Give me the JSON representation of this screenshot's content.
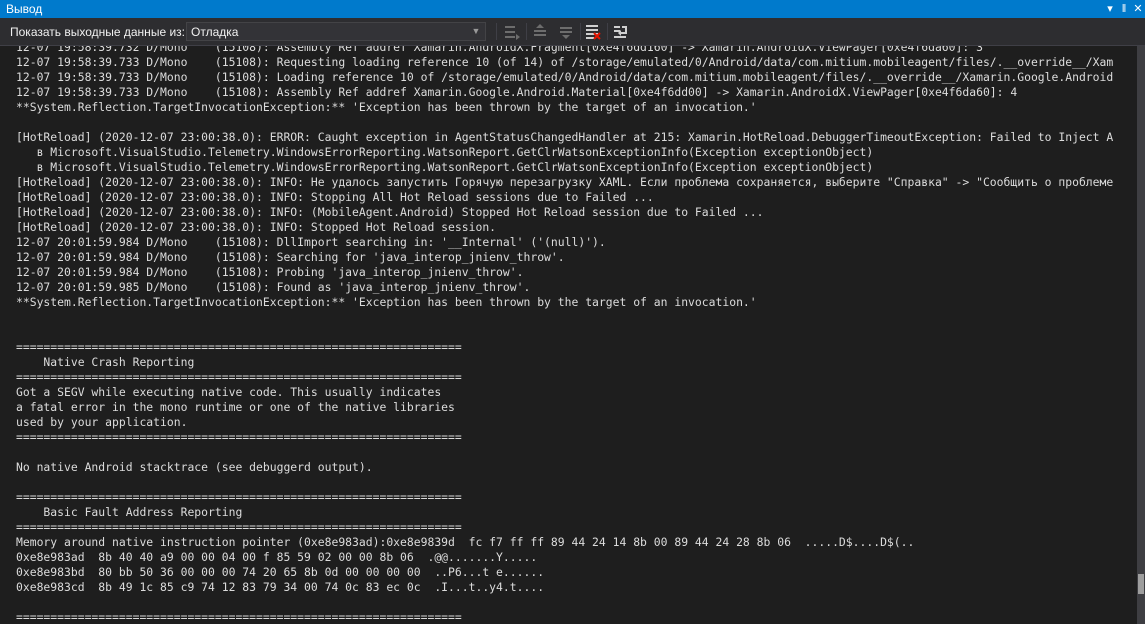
{
  "window": {
    "title": "Вывод",
    "pin_glyph": "‖",
    "close_glyph": "✕",
    "menu_glyph": "▾"
  },
  "toolbar": {
    "show_output_label": "Показать выходные данные из:",
    "source_value": "Отладка",
    "buttons": [
      "find-message-icon",
      "go-to-previous-icon",
      "go-to-next-icon",
      "clear-all-icon",
      "toggle-word-wrap-icon"
    ]
  },
  "colors": {
    "title_bar": "#007acc",
    "background": "#1e1e1e",
    "text": "#dcdcdc",
    "toolbar": "#2d2d30"
  },
  "output": {
    "lines": [
      "12-07 19:58:39.732 D/Mono    (15108): Assembly Ref addref Xamarin.AndroidX.Fragment[0xe4f6dd160] -> Xamarin.AndroidX.ViewPager[0xe4f6da60]: 3",
      "12-07 19:58:39.733 D/Mono    (15108): Requesting loading reference 10 (of 14) of /storage/emulated/0/Android/data/com.mitium.mobileagent/files/.__override__/Xam",
      "12-07 19:58:39.733 D/Mono    (15108): Loading reference 10 of /storage/emulated/0/Android/data/com.mitium.mobileagent/files/.__override__/Xamarin.Google.Android",
      "12-07 19:58:39.733 D/Mono    (15108): Assembly Ref addref Xamarin.Google.Android.Material[0xe4f6dd00] -> Xamarin.AndroidX.ViewPager[0xe4f6da60]: 4",
      "**System.Reflection.TargetInvocationException:** 'Exception has been thrown by the target of an invocation.'",
      "",
      "[HotReload] (2020-12-07 23:00:38.0): ERROR: Caught exception in AgentStatusChangedHandler at 215: Xamarin.HotReload.DebuggerTimeoutException: Failed to Inject A",
      "   в Microsoft.VisualStudio.Telemetry.WindowsErrorReporting.WatsonReport.GetClrWatsonExceptionInfo(Exception exceptionObject)",
      "   в Microsoft.VisualStudio.Telemetry.WindowsErrorReporting.WatsonReport.GetClrWatsonExceptionInfo(Exception exceptionObject)",
      "[HotReload] (2020-12-07 23:00:38.0): INFO: Не удалось запустить Горячую перезагрузку XAML. Если проблема сохраняется, выберите \"Справка\" -> \"Сообщить о проблеме",
      "[HotReload] (2020-12-07 23:00:38.0): INFO: Stopping All Hot Reload sessions due to Failed ...",
      "[HotReload] (2020-12-07 23:00:38.0): INFO: (MobileAgent.Android) Stopped Hot Reload session due to Failed ...",
      "[HotReload] (2020-12-07 23:00:38.0): INFO: Stopped Hot Reload session.",
      "12-07 20:01:59.984 D/Mono    (15108): DllImport searching in: '__Internal' ('(null)').",
      "12-07 20:01:59.984 D/Mono    (15108): Searching for 'java_interop_jnienv_throw'.",
      "12-07 20:01:59.984 D/Mono    (15108): Probing 'java_interop_jnienv_throw'.",
      "12-07 20:01:59.985 D/Mono    (15108): Found as 'java_interop_jnienv_throw'.",
      "**System.Reflection.TargetInvocationException:** 'Exception has been thrown by the target of an invocation.'",
      "",
      "",
      "=================================================================",
      "    Native Crash Reporting",
      "=================================================================",
      "Got a SEGV while executing native code. This usually indicates",
      "a fatal error in the mono runtime or one of the native libraries",
      "used by your application.",
      "=================================================================",
      "",
      "No native Android stacktrace (see debuggerd output).",
      "",
      "=================================================================",
      "    Basic Fault Address Reporting",
      "=================================================================",
      "Memory around native instruction pointer (0xe8e983ad):0xe8e9839d  fc f7 ff ff 89 44 24 14 8b 00 89 44 24 28 8b 06  .....D$....D$(..",
      "0xe8e983ad  8b 40 40 a9 00 00 04 00 f 85 59 02 00 00 8b 06  .@@.......Y.....",
      "0xe8e983bd  80 bb 50 36 00 00 00 74 20 65 8b 0d 00 00 00 00  ..P6...t e......",
      "0xe8e983cd  8b 49 1c 85 c9 74 12 83 79 34 00 74 0c 83 ec 0c  .I...t..y4.t....",
      "",
      "================================================================="
    ]
  }
}
